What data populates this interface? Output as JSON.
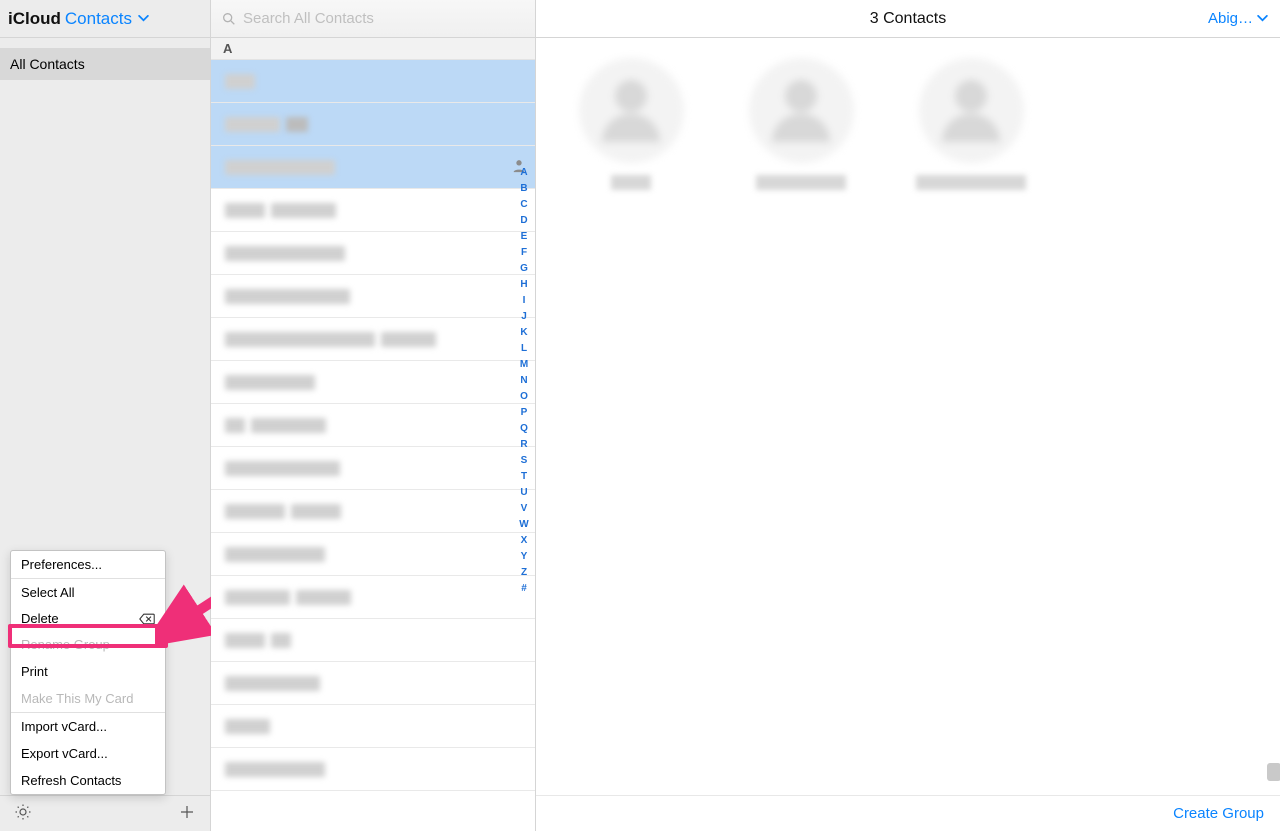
{
  "header": {
    "icloud": "iCloud",
    "app_name": "Contacts",
    "search_placeholder": "Search All Contacts"
  },
  "sidebar": {
    "groups": [
      "All Contacts"
    ]
  },
  "contacts_section_letter": "A",
  "alpha_index": [
    "A",
    "B",
    "C",
    "D",
    "E",
    "F",
    "G",
    "H",
    "I",
    "J",
    "K",
    "L",
    "M",
    "N",
    "O",
    "P",
    "Q",
    "R",
    "S",
    "T",
    "U",
    "V",
    "W",
    "X",
    "Y",
    "Z",
    "#"
  ],
  "detail": {
    "title": "3 Contacts",
    "user_label": "Abig…",
    "create_group": "Create Group"
  },
  "menu": {
    "preferences": "Preferences...",
    "select_all": "Select All",
    "delete": "Delete",
    "rename_group": "Rename Group",
    "print": "Print",
    "make_card": "Make This My Card",
    "import": "Import vCard...",
    "export": "Export vCard...",
    "refresh": "Refresh Contacts"
  }
}
